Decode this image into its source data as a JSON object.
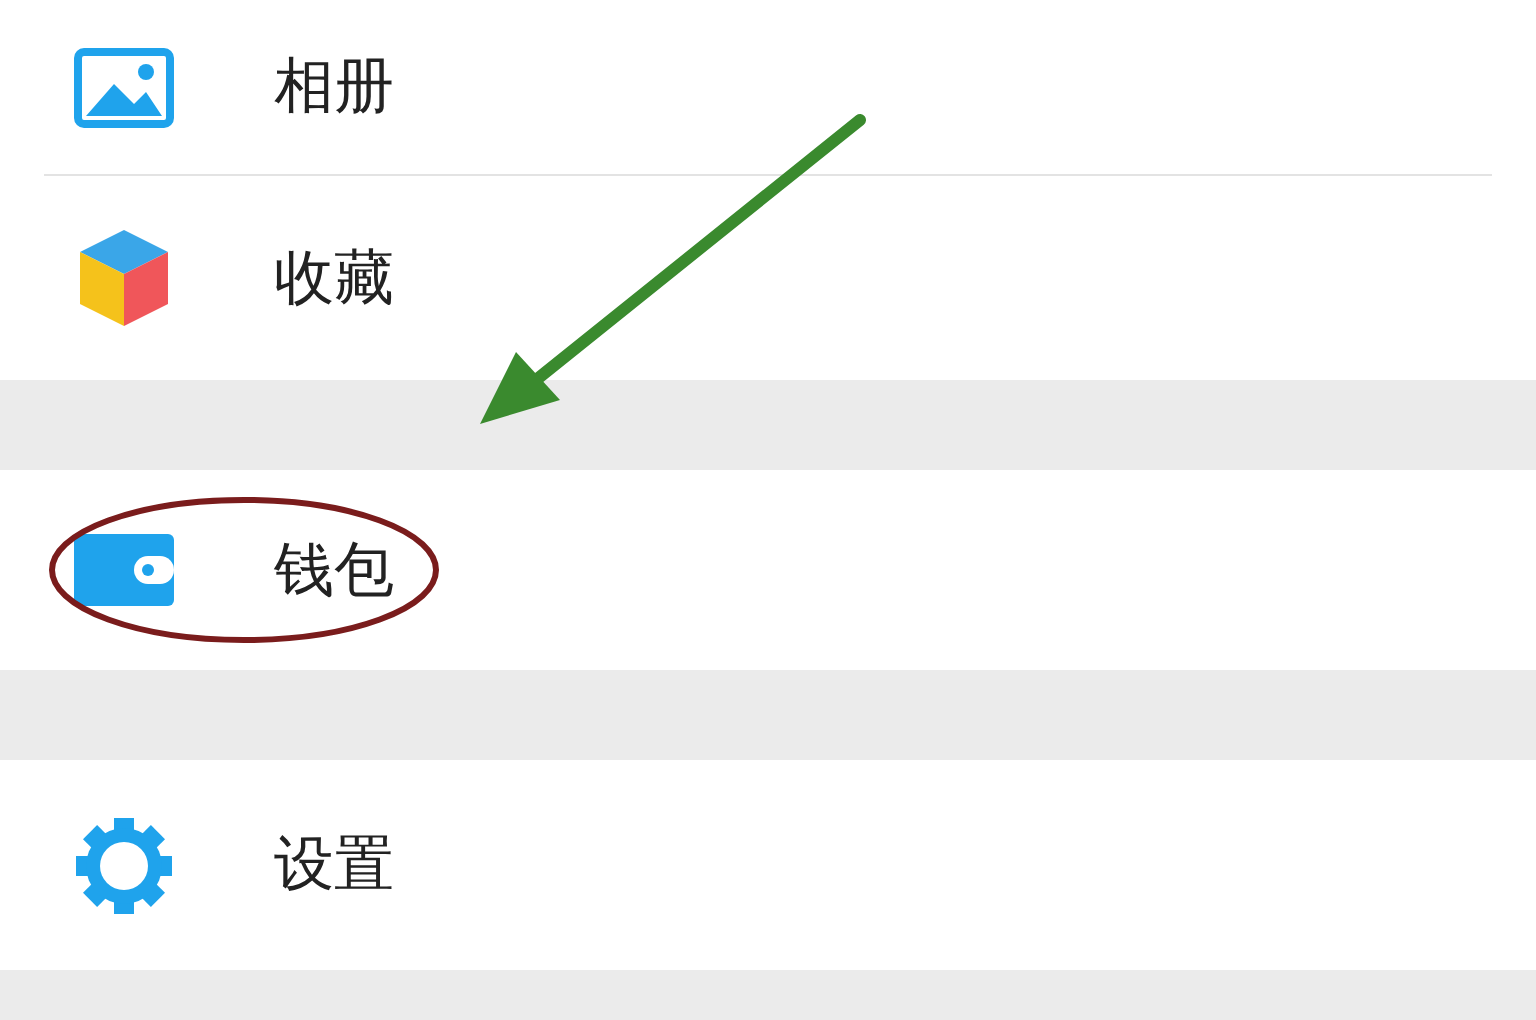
{
  "groups": [
    {
      "items": [
        {
          "label": "相册",
          "kind": "photos"
        },
        {
          "label": "收藏",
          "kind": "favorites"
        }
      ]
    },
    {
      "items": [
        {
          "label": "钱包",
          "kind": "wallet"
        }
      ]
    },
    {
      "items": [
        {
          "label": "设置",
          "kind": "settings"
        }
      ]
    }
  ]
}
